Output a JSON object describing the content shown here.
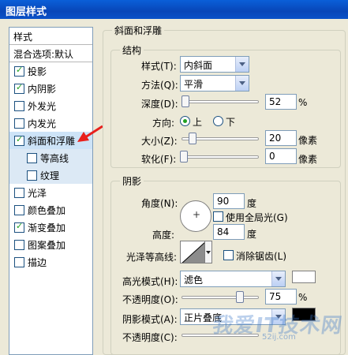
{
  "window": {
    "title": "图层样式"
  },
  "style_list": {
    "header": "样式",
    "blend_options": "混合选项:默认",
    "items": [
      {
        "label": "投影",
        "checked": true
      },
      {
        "label": "内阴影",
        "checked": true
      },
      {
        "label": "外发光",
        "checked": false
      },
      {
        "label": "内发光",
        "checked": false
      },
      {
        "label": "斜面和浮雕",
        "checked": true,
        "selected": true
      },
      {
        "label": "等高线",
        "checked": false,
        "sub": true
      },
      {
        "label": "纹理",
        "checked": false,
        "sub": true
      },
      {
        "label": "光泽",
        "checked": false
      },
      {
        "label": "颜色叠加",
        "checked": false
      },
      {
        "label": "渐变叠加",
        "checked": true
      },
      {
        "label": "图案叠加",
        "checked": false
      },
      {
        "label": "描边",
        "checked": false
      }
    ]
  },
  "bevel_emboss": {
    "title": "斜面和浮雕",
    "structure": {
      "title": "结构",
      "style_label": "样式(T):",
      "style_value": "内斜面",
      "technique_label": "方法(Q):",
      "technique_value": "平滑",
      "depth_label": "深度(D):",
      "depth_value": "52",
      "depth_unit": "%",
      "depth_level": 0.0,
      "direction_label": "方向:",
      "direction_up": "上",
      "direction_down": "下",
      "size_label": "大小(Z):",
      "size_value": "20",
      "size_unit": "像素",
      "soften_label": "软化(F):",
      "soften_value": "0",
      "soften_unit": "像素"
    },
    "shading": {
      "title": "阴影",
      "angle_label": "角度(N):",
      "angle_value": "90",
      "angle_unit": "度",
      "global_light_label": "使用全局光(G)",
      "altitude_label": "高度:",
      "altitude_value": "84",
      "altitude_unit": "度",
      "gloss_contour_label": "光泽等高线:",
      "antialias_label": "消除锯齿(L)",
      "highlight_mode_label": "高光模式(H):",
      "highlight_mode_value": "滤色",
      "highlight_color": "#ffffff",
      "highlight_opacity_label": "不透明度(O):",
      "highlight_opacity_value": "75",
      "highlight_opacity_unit": "%",
      "shadow_mode_label": "阴影模式(A):",
      "shadow_mode_value": "正片叠底",
      "shadow_color": "#000000",
      "shadow_opacity_label": "不透明度(C):"
    }
  },
  "watermark": {
    "text": "我爱IT技术网",
    "url": "52ij.com"
  }
}
